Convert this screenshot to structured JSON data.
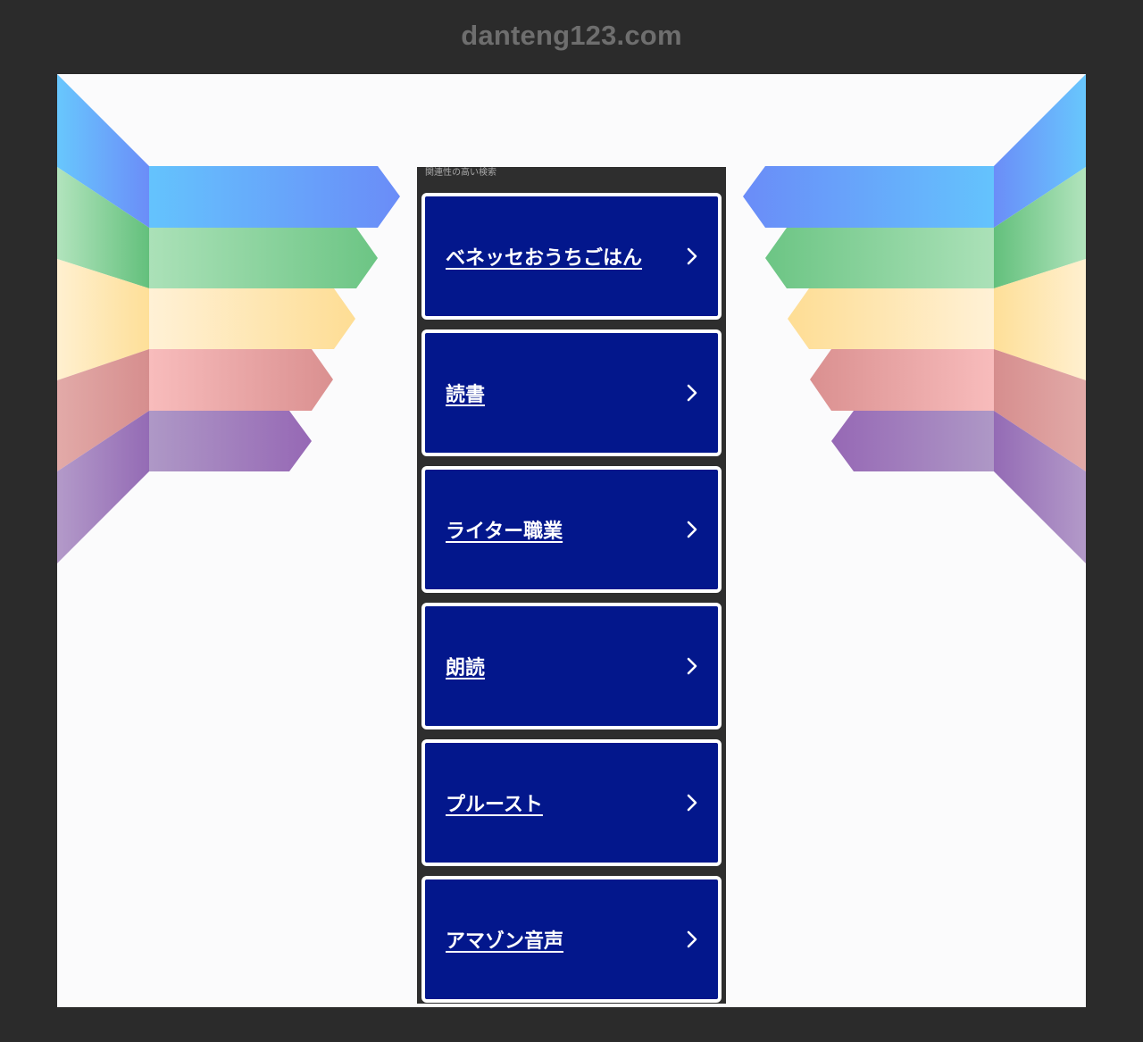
{
  "header": {
    "domain": "danteng123.com"
  },
  "panel": {
    "caption": "関連性の高い検索",
    "links": [
      {
        "label": "ベネッセおうちごはん"
      },
      {
        "label": "読書"
      },
      {
        "label": "ライター職業"
      },
      {
        "label": "朗読"
      },
      {
        "label": "プルースト"
      },
      {
        "label": "アマゾン音声"
      }
    ]
  },
  "colors": {
    "page_background": "#2b2b2b",
    "canvas_background": "#fbfbfc",
    "panel_background": "#2e2e2e",
    "link_background": "#03178c",
    "link_border": "#ffffff",
    "ribbon_blue": "#6a8ff8",
    "ribbon_green": "#6cc484",
    "ribbon_yellow": "#fee29e",
    "ribbon_red": "#dc9496",
    "ribbon_purple": "#9a6fb7"
  }
}
